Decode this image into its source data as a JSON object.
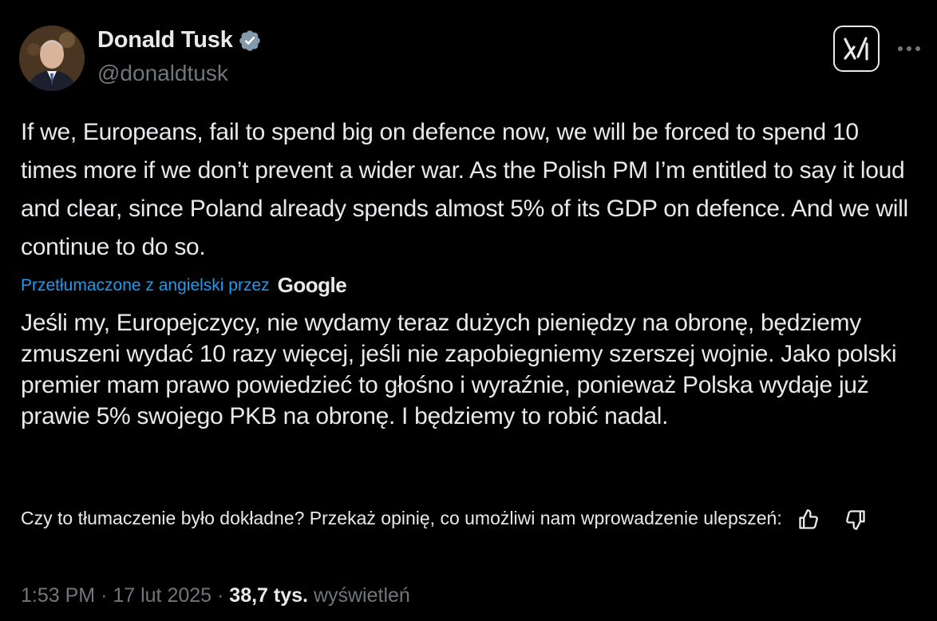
{
  "author": {
    "display_name": "Donald Tusk",
    "handle": "@donaldtusk",
    "verified_color": "#829aab"
  },
  "tweet": {
    "text": "If we, Europeans, fail to spend big on defence now, we will be forced to spend 10 times more if we don’t prevent a wider war. As the Polish PM I’m entitled to say it loud and clear, since Poland already spends almost 5% of its GDP on defence. And we will continue to do so."
  },
  "translation": {
    "link_label": "Przetłumaczone z angielski przez",
    "provider": "Google",
    "text": "Jeśli my, Europejczycy, nie wydamy teraz dużych pieniędzy na obronę, będziemy zmuszeni wydać 10 razy więcej, jeśli nie zapobiegniemy szerszej wojnie. Jako polski premier mam prawo powiedzieć to głośno i wyraźnie, ponieważ Polska wydaje już prawie 5% swojego PKB na obronę. I będziemy to robić nadal.",
    "feedback_prompt": "Czy to tłumaczenie było dokładne? Przekaż opinię, co umożliwi nam wprowadzenie ulepszeń:"
  },
  "meta": {
    "time": "1:53 PM",
    "separator": "·",
    "date": "17 lut 2025",
    "views_count": "38,7 tys.",
    "views_label": "wyświetleń"
  },
  "icons": {
    "verified": "verified-badge-icon",
    "grok": "grok-icon",
    "more": "more-options-icon",
    "thumbs_up": "thumbs-up-icon",
    "thumbs_down": "thumbs-down-icon"
  },
  "colors": {
    "background": "#000000",
    "text": "#e7e9ea",
    "secondary": "#71767b",
    "link": "#1d9bf0"
  }
}
